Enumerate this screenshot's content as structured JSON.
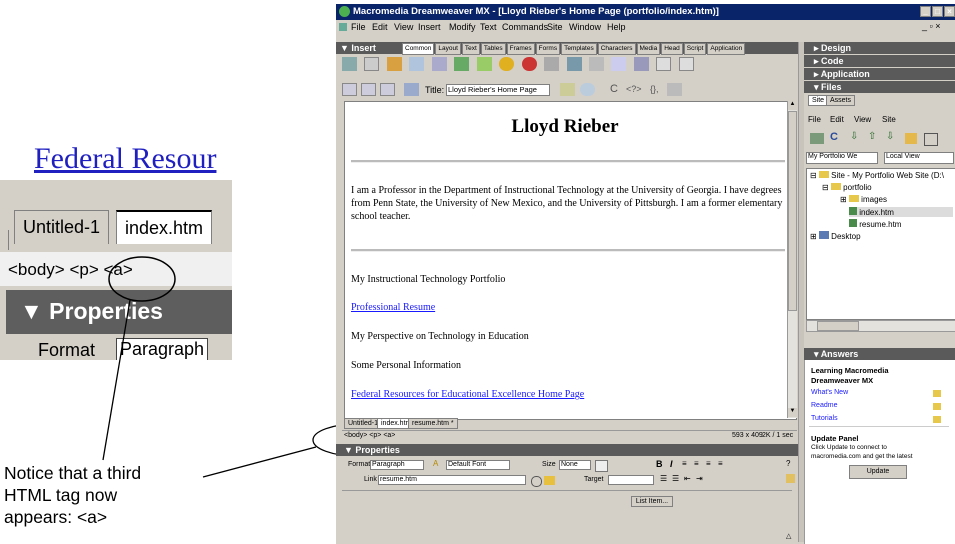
{
  "zoom": {
    "link_text": "Federal Resour",
    "tabs": [
      "Untitled-1",
      "index.htm"
    ],
    "tag_bar": "<body> <p> <a>",
    "properties_label": "Properties",
    "format_label": "Format",
    "format_value": "Paragraph"
  },
  "caption": {
    "lines": [
      "Notice that a third",
      "HTML tag now",
      "appears: <a>"
    ]
  },
  "window": {
    "title": "Macromedia Dreamweaver MX - [Lloyd Rieber's Home Page (portfolio/index.htm)]",
    "title_buttons": [
      "_",
      "□",
      "×"
    ],
    "menu": [
      "File",
      "Edit",
      "View",
      "Insert",
      "Modify",
      "Text",
      "Commands",
      "Site",
      "Window",
      "Help"
    ],
    "insert_panel": {
      "label": "Insert",
      "tabs": [
        "Common",
        "Layout",
        "Text",
        "Tables",
        "Frames",
        "Forms",
        "Templates",
        "Characters",
        "Media",
        "Head",
        "Script",
        "Application"
      ]
    },
    "doc_toolbar": {
      "title_label": "Title:",
      "title_value": "Lloyd Rieber's Home Page"
    },
    "document": {
      "heading": "Lloyd Rieber",
      "paragraph": "I am a Professor in the Department of Instructional Technology at the University of Georgia. I have degrees from Penn State, the University of New Mexico, and the University of Pittsburgh. I am a former elementary school teacher.",
      "items": [
        {
          "text": "My Instructional Technology Portfolio",
          "link": false
        },
        {
          "text": "Professional Resume",
          "link": true
        },
        {
          "text": "My Perspective on Technology in Education",
          "link": false
        },
        {
          "text": "Some Personal Information",
          "link": false
        },
        {
          "text": "Federal Resources for Educational Excellence Home Page",
          "link": true
        }
      ]
    },
    "doc_tabs": [
      "Untitled-1",
      "index.htm",
      "resume.htm *"
    ],
    "status": {
      "tag_selector": "<body> <p> <a>",
      "size": "593 x 409",
      "download": "2K / 1 sec"
    },
    "properties": {
      "label": "Properties",
      "format_label": "Format",
      "format_value": "Paragraph",
      "font_value": "Default Font",
      "size_label": "Size",
      "size_value": "None",
      "link_label": "Link",
      "link_value": "resume.htm",
      "target_label": "Target",
      "list_item_button": "List Item..."
    },
    "right_panels": {
      "collapsed": [
        "Design",
        "Code",
        "Application"
      ],
      "files": {
        "label": "Files",
        "tabs": [
          "Site",
          "Assets"
        ],
        "menu": [
          "File",
          "Edit",
          "View",
          "Site"
        ],
        "site_select": "My Portfolio We",
        "view_select": "Local View",
        "tree": [
          {
            "label": "Site - My Portfolio Web Site (D:\\",
            "level": 0,
            "icon": "folder-icon"
          },
          {
            "label": "portfolio",
            "level": 1,
            "icon": "folder-icon"
          },
          {
            "label": "images",
            "level": 2,
            "icon": "folder-icon"
          },
          {
            "label": "index.htm",
            "level": 3,
            "icon": "html-file-icon"
          },
          {
            "label": "resume.htm",
            "level": 3,
            "icon": "html-file-icon"
          },
          {
            "label": "Desktop",
            "level": 0,
            "icon": "desktop-icon"
          }
        ]
      },
      "answers": {
        "label": "Answers",
        "heading_line1": "Learning Macromedia",
        "heading_line2": "Dreamweaver MX",
        "links": [
          "What's New",
          "Readme",
          "Tutorials"
        ],
        "update_title": "Update Panel",
        "update_text_line1": "Click Update to connect to",
        "update_text_line2": "macromedia.com and get the latest",
        "update_button": "Update"
      }
    }
  }
}
